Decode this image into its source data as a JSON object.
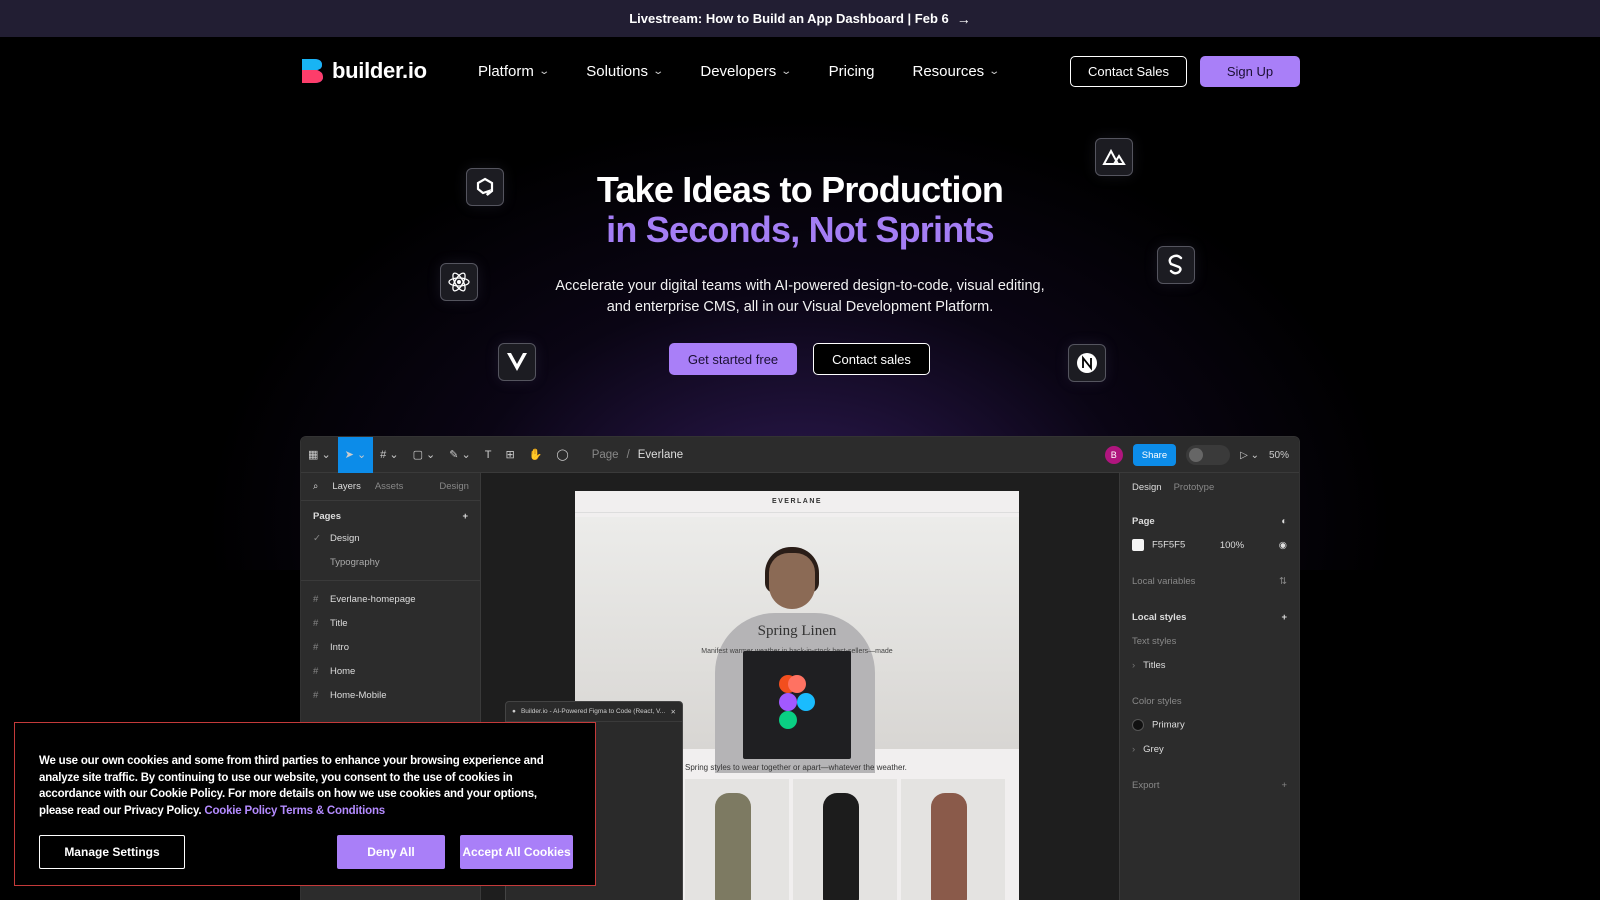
{
  "announcement": {
    "text": "Livestream: How to Build an App Dashboard | Feb 6",
    "arrow": "→"
  },
  "brand": {
    "name": "builder.io"
  },
  "nav": {
    "items": [
      {
        "label": "Platform",
        "has_dropdown": true
      },
      {
        "label": "Solutions",
        "has_dropdown": true
      },
      {
        "label": "Developers",
        "has_dropdown": true
      },
      {
        "label": "Pricing",
        "has_dropdown": false
      },
      {
        "label": "Resources",
        "has_dropdown": true
      }
    ],
    "contact_sales": "Contact Sales",
    "sign_up": "Sign Up"
  },
  "hero": {
    "title_line1": "Take Ideas to Production",
    "title_line2": "in Seconds, Not Sprints",
    "subtitle": "Accelerate your digital teams with AI-powered design-to-code, visual editing, and enterprise CMS, all in our Visual Development Platform.",
    "cta_primary": "Get started free",
    "cta_secondary": "Contact sales"
  },
  "framework_icons": [
    "qwik-icon",
    "react-icon",
    "vue-icon",
    "nuxt-icon",
    "svelte-icon",
    "next-icon"
  ],
  "editor": {
    "breadcrumb": [
      "Page",
      "/",
      "Everlane"
    ],
    "avatar": "B",
    "share": "Share",
    "zoom": "50%",
    "left_tabs": [
      "Layers",
      "Assets",
      "Design"
    ],
    "pages_label": "Pages",
    "pages": [
      "Design",
      "Typography"
    ],
    "layers": [
      "Everlane-homepage",
      "Title",
      "Intro",
      "Home",
      "Home-Mobile"
    ],
    "right_tabs": [
      "Design",
      "Prototype"
    ],
    "page_label": "Page",
    "page_fill": "F5F5F5",
    "page_opacity": "100%",
    "local_variables": "Local variables",
    "local_styles": "Local styles",
    "text_styles": "Text styles",
    "titles": "Titles",
    "color_styles": "Color styles",
    "primary": "Primary",
    "grey": "Grey",
    "export": "Export",
    "plugin_title": "Builder.io - AI-Powered Figma to Code (React, V...",
    "site": {
      "brand": "EVERLANE",
      "title": "Spring Linen",
      "desc": "Manifest warmer weather in back-in-stock best-sellers—made from the season's favorite fabric.",
      "caption": "Spring styles to wear together or apart—whatever the weather."
    }
  },
  "cookie": {
    "text": "We use our own cookies and some from third parties to enhance your browsing experience and analyze site traffic. By continuing to use our website, you consent to the use of cookies in accordance with our Cookie Policy. For more details on how we use cookies and your options, please read our Privacy Policy.",
    "link_policy": "Cookie Policy",
    "link_terms": "Terms & Conditions",
    "manage": "Manage Settings",
    "deny": "Deny All",
    "accept": "Accept All Cookies"
  },
  "colors": {
    "accent": "#a97ff8",
    "title_purple": "#a47ef5",
    "announce_bg": "#221e33",
    "figma_blue": "#0c8ce9"
  }
}
